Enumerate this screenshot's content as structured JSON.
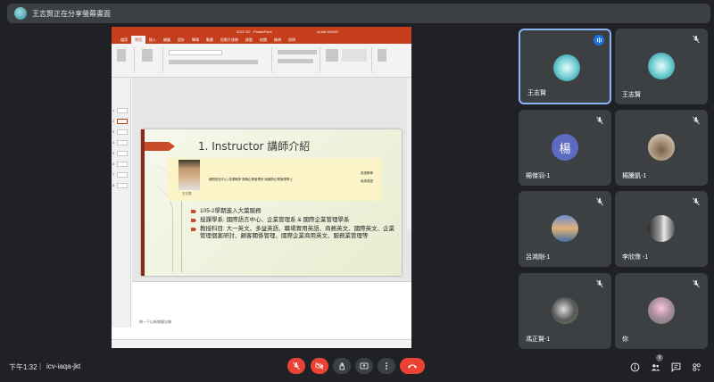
{
  "banner": {
    "text": "王志賢正在分享螢幕畫面"
  },
  "ppt": {
    "window_title": "2022 SC · PowerPoint",
    "user": "ALAN WANG",
    "tabs": [
      "檔案",
      "常用",
      "插入",
      "繪圖",
      "設計",
      "轉場",
      "動畫",
      "投影片放映",
      "錄製",
      "校閱",
      "檢視",
      "說明"
    ],
    "active_tab": "常用",
    "slide_numbers": [
      "1",
      "2",
      "3",
      "4",
      "5",
      "6",
      "7",
      "8"
    ],
    "slide": {
      "title": "1. Instructor 講師介紹",
      "photo_caption": "王志賢",
      "info_desc": "國際語言中心 成課教師 專職企業管理系 與國際企業管理學士",
      "info_right_1": "英語教學",
      "info_right_2": "商用英語",
      "bullets": [
        "105-2學期進入大葉服務",
        "授課學系: 國際語言中心、企業管理系 & 國際企業管理學系",
        "教授科目: 大一英文、多益英語、職場實用英語、商務英文、國際英文、企業管理個案研討、顧客關係管理、國際企業商用英文、服務業管理等"
      ]
    },
    "notes_placeholder": "按一下以新增備忘稿"
  },
  "participants": [
    {
      "name": "王志賢",
      "avatar": "logo",
      "speaking": true
    },
    {
      "name": "王志賢",
      "avatar": "logo",
      "speaking": false
    },
    {
      "name": "楊傑羽-1",
      "avatar": "letter",
      "letter": "楊",
      "speaking": false
    },
    {
      "name": "楊騰凱-1",
      "avatar": "dog",
      "speaking": false
    },
    {
      "name": "呂鴻剛-1",
      "avatar": "kids",
      "speaking": false
    },
    {
      "name": "李欣霈 -1",
      "avatar": "tower",
      "speaking": false
    },
    {
      "name": "馮正賢-1",
      "avatar": "helmet",
      "speaking": false
    },
    {
      "name": "你",
      "avatar": "blossom",
      "speaking": false
    }
  ],
  "bottom": {
    "time": "下午1:32",
    "separator": "|",
    "meeting_code": "icv-iaqa-jkt",
    "people_count": "9"
  },
  "colors": {
    "accent": "#8ab4f8",
    "danger": "#ea4335",
    "ppt": "#c43e1c"
  }
}
